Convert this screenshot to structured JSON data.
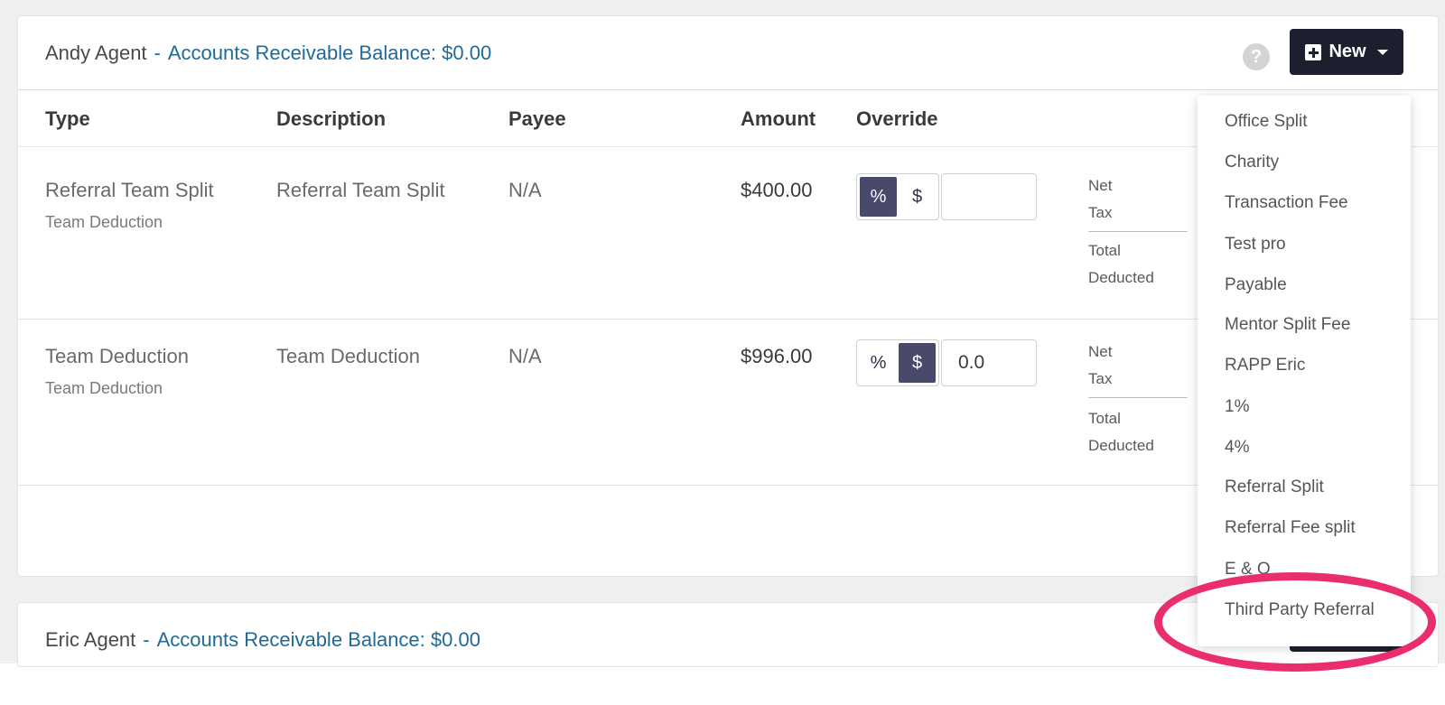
{
  "card1": {
    "agent_name": "Andy Agent",
    "separator": "-",
    "balance_label": "Accounts Receivable Balance: $0.00",
    "help_icon": "question-circle-icon",
    "new_label": "New"
  },
  "table": {
    "headers": [
      "Type",
      "Description",
      "Payee",
      "Amount",
      "Override"
    ],
    "rows": [
      {
        "type": "Referral Team Split",
        "type_sub": "Team Deduction",
        "description": "Referral Team Split",
        "payee": "N/A",
        "amount": "$400.00",
        "toggle_percent": "%",
        "toggle_dollar": "$",
        "selected": "%",
        "override_value": "",
        "net": "Net",
        "tax": "Tax",
        "total": "Total",
        "deducted": "Deducted"
      },
      {
        "type": "Team Deduction",
        "type_sub": "Team Deduction",
        "description": "Team Deduction",
        "payee": "N/A",
        "amount": "$996.00",
        "toggle_percent": "%",
        "toggle_dollar": "$",
        "selected": "$",
        "override_value": "0.0",
        "net": "Net",
        "tax": "Tax",
        "total": "Total",
        "deducted": "Deducted"
      }
    ]
  },
  "card2": {
    "agent_name": "Eric Agent",
    "separator": "-",
    "balance_label": "Accounts Receivable Balance: $0.00"
  },
  "dropdown": {
    "items": [
      "Office Split",
      "Charity",
      "Transaction Fee",
      "Test pro",
      "Payable",
      "Mentor Split Fee",
      "RAPP Eric",
      "1%",
      "4%",
      "Referral Split",
      "Referral Fee split",
      "E & O",
      "Third Party Referral"
    ]
  },
  "colors": {
    "accent_link": "#1f6a99",
    "button_dark": "#1d1f2e",
    "toggle_active": "#494a6b",
    "highlight": "#ea2d6f"
  }
}
